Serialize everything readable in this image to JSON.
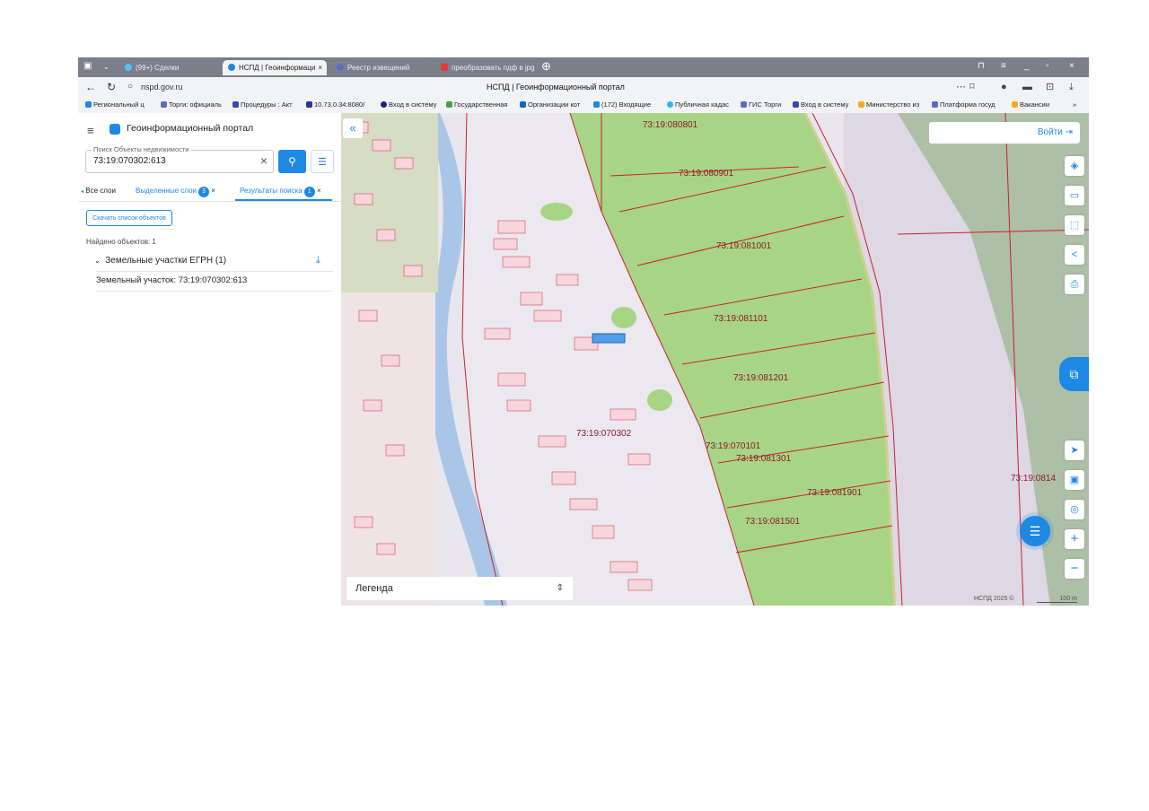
{
  "browser": {
    "tabs": [
      {
        "label": "(99+) Сделки",
        "active": false
      },
      {
        "label": "НСПД | Геоинформаци",
        "active": true
      },
      {
        "label": "Реестр извещений",
        "active": false
      },
      {
        "label": "преобразовать пдф в jpg",
        "active": false
      }
    ],
    "url": "nspd.gov.ru",
    "page_title": "НСПД | Геоинформационный портал",
    "bookmarks": [
      "Региональный ц",
      "Торги: официаль",
      "Процедуры : Акт",
      "10.73.0.34:8080/",
      "Вход в систему",
      "Государственная",
      "Организации кот",
      "(172) Входящие",
      "Публичная кадас",
      "ГИС Торги",
      "Вход в систему",
      "Министерство из",
      "Платформа госуд",
      "Вакансии"
    ]
  },
  "panel": {
    "title": "Геоинформационный портал",
    "search_label": "Поиск Объекты недвижимости",
    "search_value": "73:19:070302:613",
    "tabs": [
      {
        "label": "Все слои"
      },
      {
        "label": "Выделенные слои",
        "count": "3"
      },
      {
        "label": "Результаты поиска",
        "count": "1"
      }
    ],
    "download_button": "Скачать список объектов",
    "found": "Найдено объектов: 1",
    "group_title": "Земельные участки ЕГРН (1)",
    "result_item": "Земельный участок: 73:19:070302:613"
  },
  "map": {
    "login_label": "Войти",
    "legend_label": "Легенда",
    "copyright": "НСПД 2025 ©",
    "scale_label": "100 m",
    "parcel_labels": [
      "73:19:080801",
      "73:19:080901",
      "73:19:081001",
      "73:19:081101",
      "73:19:081201",
      "73:19:070302",
      "73:19:070101",
      "73:19:081301",
      "73:19:081901",
      "73:19:081501",
      "73:19:0814"
    ],
    "colors": {
      "forest": "#a7d585",
      "parcel_border": "#c8202e",
      "river": "#a9c6e8",
      "accent": "#1e88e5"
    }
  }
}
